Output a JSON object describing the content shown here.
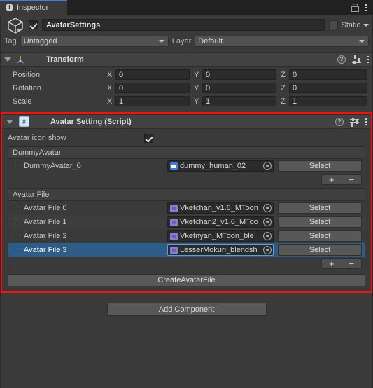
{
  "tab": {
    "label": "Inspector",
    "icon": "info-icon",
    "lock_icon": "lock-icon",
    "menu_icon": "kebab-menu-icon"
  },
  "gameobject": {
    "icon": "cube-icon",
    "enabled": true,
    "name": "AvatarSettings",
    "static_label": "Static",
    "static_checked": false,
    "tag_label": "Tag",
    "tag_value": "Untagged",
    "layer_label": "Layer",
    "layer_value": "Default"
  },
  "transform": {
    "title": "Transform",
    "icon": "transform-axis-icon",
    "help_icon": "help-icon",
    "preset_icon": "preset-sliders-icon",
    "menu_icon": "kebab-menu-icon",
    "rows": [
      {
        "label": "Position",
        "x": "0",
        "y": "0",
        "z": "0"
      },
      {
        "label": "Rotation",
        "x": "0",
        "y": "0",
        "z": "0"
      },
      {
        "label": "Scale",
        "x": "1",
        "y": "1",
        "z": "1"
      }
    ],
    "axis_labels": {
      "x": "X",
      "y": "Y",
      "z": "Z"
    }
  },
  "script_component": {
    "title": "Avatar Setting (Script)",
    "icon": "csharp-script-icon",
    "help_icon": "help-icon",
    "preset_icon": "preset-sliders-icon",
    "menu_icon": "kebab-menu-icon",
    "highlight_color": "#ee1414",
    "avatar_icon_show": {
      "label": "Avatar icon show",
      "checked": true
    },
    "dummy_avatar_list": {
      "header": "DummyAvatar",
      "rows": [
        {
          "label": "DummyAvatar_0",
          "object_value": "dummy_human_02",
          "object_icon": "prefab-icon",
          "select_label": "Select",
          "selected": false
        }
      ],
      "add_label": "+",
      "remove_label": "−"
    },
    "avatar_file_list": {
      "header": "Avatar File",
      "rows": [
        {
          "label": "Avatar File 0",
          "object_value": "Vketchan_v1.6_MToon",
          "object_icon": "vrm-asset-icon",
          "select_label": "Select",
          "selected": false
        },
        {
          "label": "Avatar File 1",
          "object_value": "Vketchan2_v1.6_MToo",
          "object_icon": "vrm-asset-icon",
          "select_label": "Select",
          "selected": false
        },
        {
          "label": "Avatar File 2",
          "object_value": "Vketnyan_MToon_ble",
          "object_icon": "vrm-asset-icon",
          "select_label": "Select",
          "selected": false
        },
        {
          "label": "Avatar File 3",
          "object_value": "LesserMokuri_blendsh",
          "object_icon": "vrm-asset-icon",
          "select_label": "Select",
          "selected": true
        }
      ],
      "add_label": "+",
      "remove_label": "−"
    },
    "create_button": "CreateAvatarFile"
  },
  "footer": {
    "add_component": "Add Component"
  },
  "colors": {
    "background": "#3a3a3a",
    "header": "#424242",
    "tab_accent": "#3c7fd3",
    "selection": "#2c5c87",
    "highlight_border": "#ee1414"
  }
}
